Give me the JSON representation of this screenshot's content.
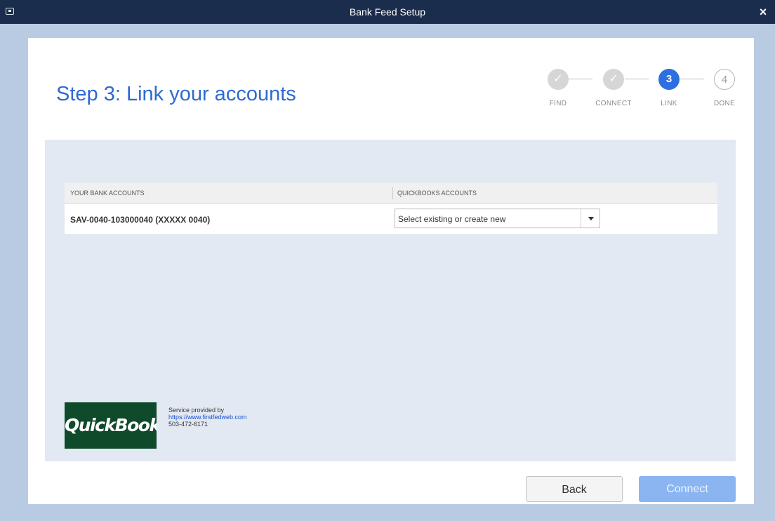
{
  "window": {
    "title": "Bank Feed Setup",
    "close_glyph": "×"
  },
  "heading": "Step 3: Link your accounts",
  "steps": [
    {
      "label": "FIND",
      "state": "done",
      "glyph": "✓"
    },
    {
      "label": "CONNECT",
      "state": "done",
      "glyph": "✓"
    },
    {
      "label": "LINK",
      "state": "active",
      "glyph": "3"
    },
    {
      "label": "DONE",
      "state": "todo",
      "glyph": "4"
    }
  ],
  "table": {
    "headers": [
      "YOUR BANK ACCOUNTS",
      "QUICKBOOKS ACCOUNTS"
    ],
    "rows": [
      {
        "bank_account": "SAV-0040-103000040 (XXXXX 0040)",
        "qb_account_placeholder": "Select existing or create new"
      }
    ]
  },
  "provider": {
    "logo_text": "QuickBooks",
    "service_label": "Service provided by",
    "url": "https://www.firstfedweb.com",
    "phone": "503-472-6171"
  },
  "buttons": {
    "back": "Back",
    "connect": "Connect"
  },
  "colors": {
    "accent": "#2c6fe0",
    "titlebar": "#1a2d4c",
    "connect_disabled": "#8bb5f0"
  }
}
